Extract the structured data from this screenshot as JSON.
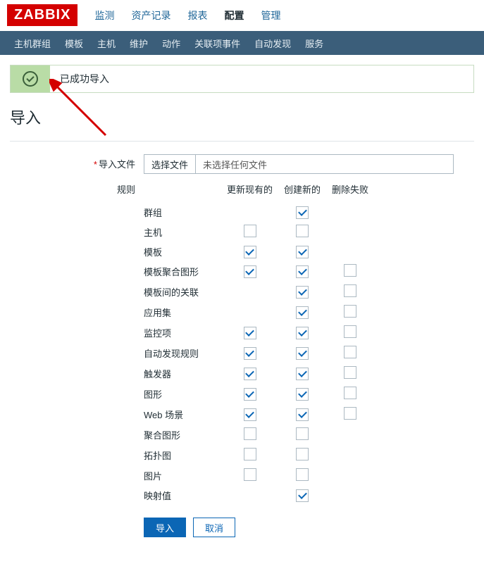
{
  "logo": "ZABBIX",
  "topnav": {
    "items": [
      "监测",
      "资产记录",
      "报表",
      "配置",
      "管理"
    ],
    "activeIndex": 3
  },
  "subnav": {
    "items": [
      "主机群组",
      "模板",
      "主机",
      "维护",
      "动作",
      "关联项事件",
      "自动发现",
      "服务"
    ]
  },
  "message": {
    "text": "已成功导入"
  },
  "page": {
    "title": "导入"
  },
  "file": {
    "label": "导入文件",
    "button": "选择文件",
    "placeholder": "未选择任何文件"
  },
  "rules": {
    "label": "规则",
    "headers": {
      "name": "",
      "update": "更新现有的",
      "create": "创建新的",
      "delete": "删除失败"
    },
    "rows": [
      {
        "name": "群组",
        "update": null,
        "create": true,
        "delete": null
      },
      {
        "name": "主机",
        "update": false,
        "create": false,
        "delete": null
      },
      {
        "name": "模板",
        "update": true,
        "create": true,
        "delete": null
      },
      {
        "name": "模板聚合图形",
        "update": true,
        "create": true,
        "delete": false
      },
      {
        "name": "模板间的关联",
        "update": null,
        "create": true,
        "delete": false
      },
      {
        "name": "应用集",
        "update": null,
        "create": true,
        "delete": false
      },
      {
        "name": "监控项",
        "update": true,
        "create": true,
        "delete": false
      },
      {
        "name": "自动发现规则",
        "update": true,
        "create": true,
        "delete": false
      },
      {
        "name": "触发器",
        "update": true,
        "create": true,
        "delete": false
      },
      {
        "name": "图形",
        "update": true,
        "create": true,
        "delete": false
      },
      {
        "name": "Web 场景",
        "update": true,
        "create": true,
        "delete": false
      },
      {
        "name": "聚合图形",
        "update": false,
        "create": false,
        "delete": null
      },
      {
        "name": "拓扑图",
        "update": false,
        "create": false,
        "delete": null
      },
      {
        "name": "图片",
        "update": false,
        "create": false,
        "delete": null
      },
      {
        "name": "映射值",
        "update": null,
        "create": true,
        "delete": null
      }
    ]
  },
  "buttons": {
    "submit": "导入",
    "cancel": "取消"
  }
}
